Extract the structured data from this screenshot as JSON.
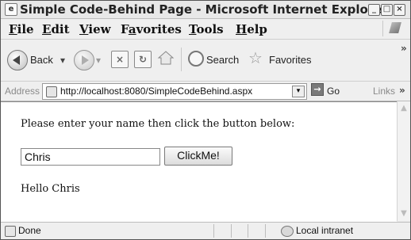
{
  "window": {
    "title": "Simple Code-Behind Page - Microsoft Internet Explorer",
    "app_icon_glyph": "e"
  },
  "menu": {
    "items": [
      {
        "accel": "F",
        "rest": "ile"
      },
      {
        "accel": "E",
        "rest": "dit"
      },
      {
        "accel": "V",
        "rest": "iew"
      },
      {
        "pre": "F",
        "accel": "a",
        "rest": "vorites"
      },
      {
        "accel": "T",
        "rest": "ools"
      },
      {
        "accel": "H",
        "rest": "elp"
      }
    ]
  },
  "toolbar": {
    "back_label": "Back",
    "search_label": "Search",
    "favorites_label": "Favorites",
    "more_glyph": "»"
  },
  "address_bar": {
    "label": "Address",
    "url": "http://localhost:8080/SimpleCodeBehind.aspx",
    "go_label": "Go",
    "links_label": "Links",
    "links_glyph": "»"
  },
  "page": {
    "prompt": "Please enter your name then click the button below:",
    "name_value": "Chris",
    "button_label": "ClickMe!",
    "greeting": "Hello Chris"
  },
  "status_bar": {
    "status": "Done",
    "zone": "Local intranet"
  },
  "icons": {
    "back": "back-arrow-icon",
    "forward": "forward-arrow-icon",
    "stop": "stop-icon",
    "refresh": "refresh-icon",
    "home": "home-icon",
    "search": "magnifier-icon",
    "favorites": "star-icon",
    "page": "page-icon",
    "go": "go-arrow-icon",
    "zone": "intranet-icon"
  }
}
